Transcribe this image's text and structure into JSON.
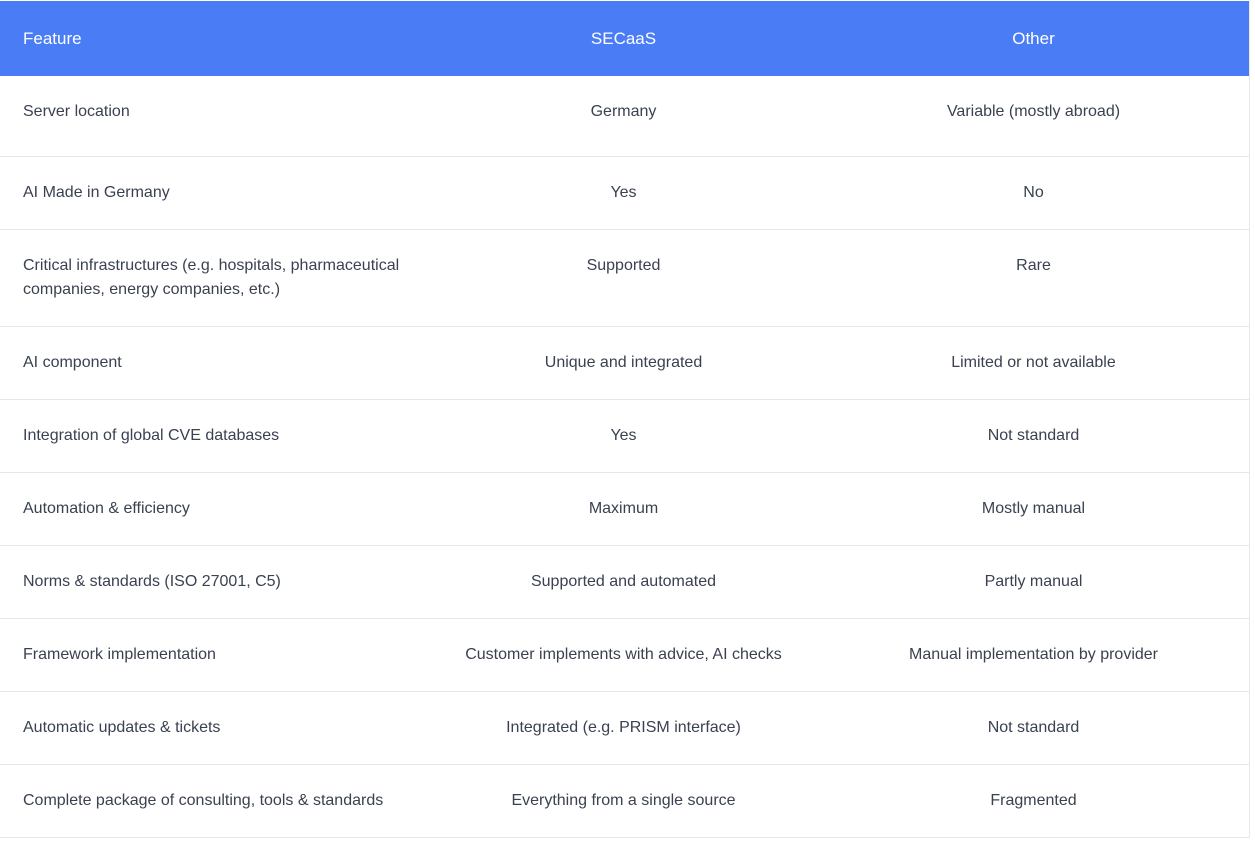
{
  "table": {
    "headers": [
      "Feature",
      "SECaaS",
      "Other"
    ],
    "rows": [
      {
        "feature": "Server location",
        "secaas": "Germany",
        "other": "Variable (mostly abroad)"
      },
      {
        "feature": "AI Made in Germany",
        "secaas": "Yes",
        "other": "No"
      },
      {
        "feature": "Critical infrastructures (e.g. hospitals, pharmaceutical companies, energy companies, etc.)",
        "secaas": "Supported",
        "other": "Rare"
      },
      {
        "feature": "AI component",
        "secaas": "Unique and integrated",
        "other": "Limited or not available"
      },
      {
        "feature": "Integration of global CVE databases",
        "secaas": "Yes",
        "other": "Not standard"
      },
      {
        "feature": "Automation & efficiency",
        "secaas": "Maximum",
        "other": "Mostly manual"
      },
      {
        "feature": "Norms & standards (ISO 27001, C5)",
        "secaas": "Supported and automated",
        "other": "Partly manual"
      },
      {
        "feature": "Framework implementation",
        "secaas": "Customer implements with advice, AI checks",
        "other": "Manual implementation by provider"
      },
      {
        "feature": "Automatic updates & tickets",
        "secaas": "Integrated (e.g. PRISM interface)",
        "other": "Not standard"
      },
      {
        "feature": "Complete package of consulting, tools & standards",
        "secaas": "Everything from a single source",
        "other": "Fragmented"
      }
    ]
  },
  "colors": {
    "header_bg": "#4a7cf6",
    "header_text": "#ffffff",
    "body_text": "#3a4150",
    "row_border": "#e4e6ea"
  }
}
